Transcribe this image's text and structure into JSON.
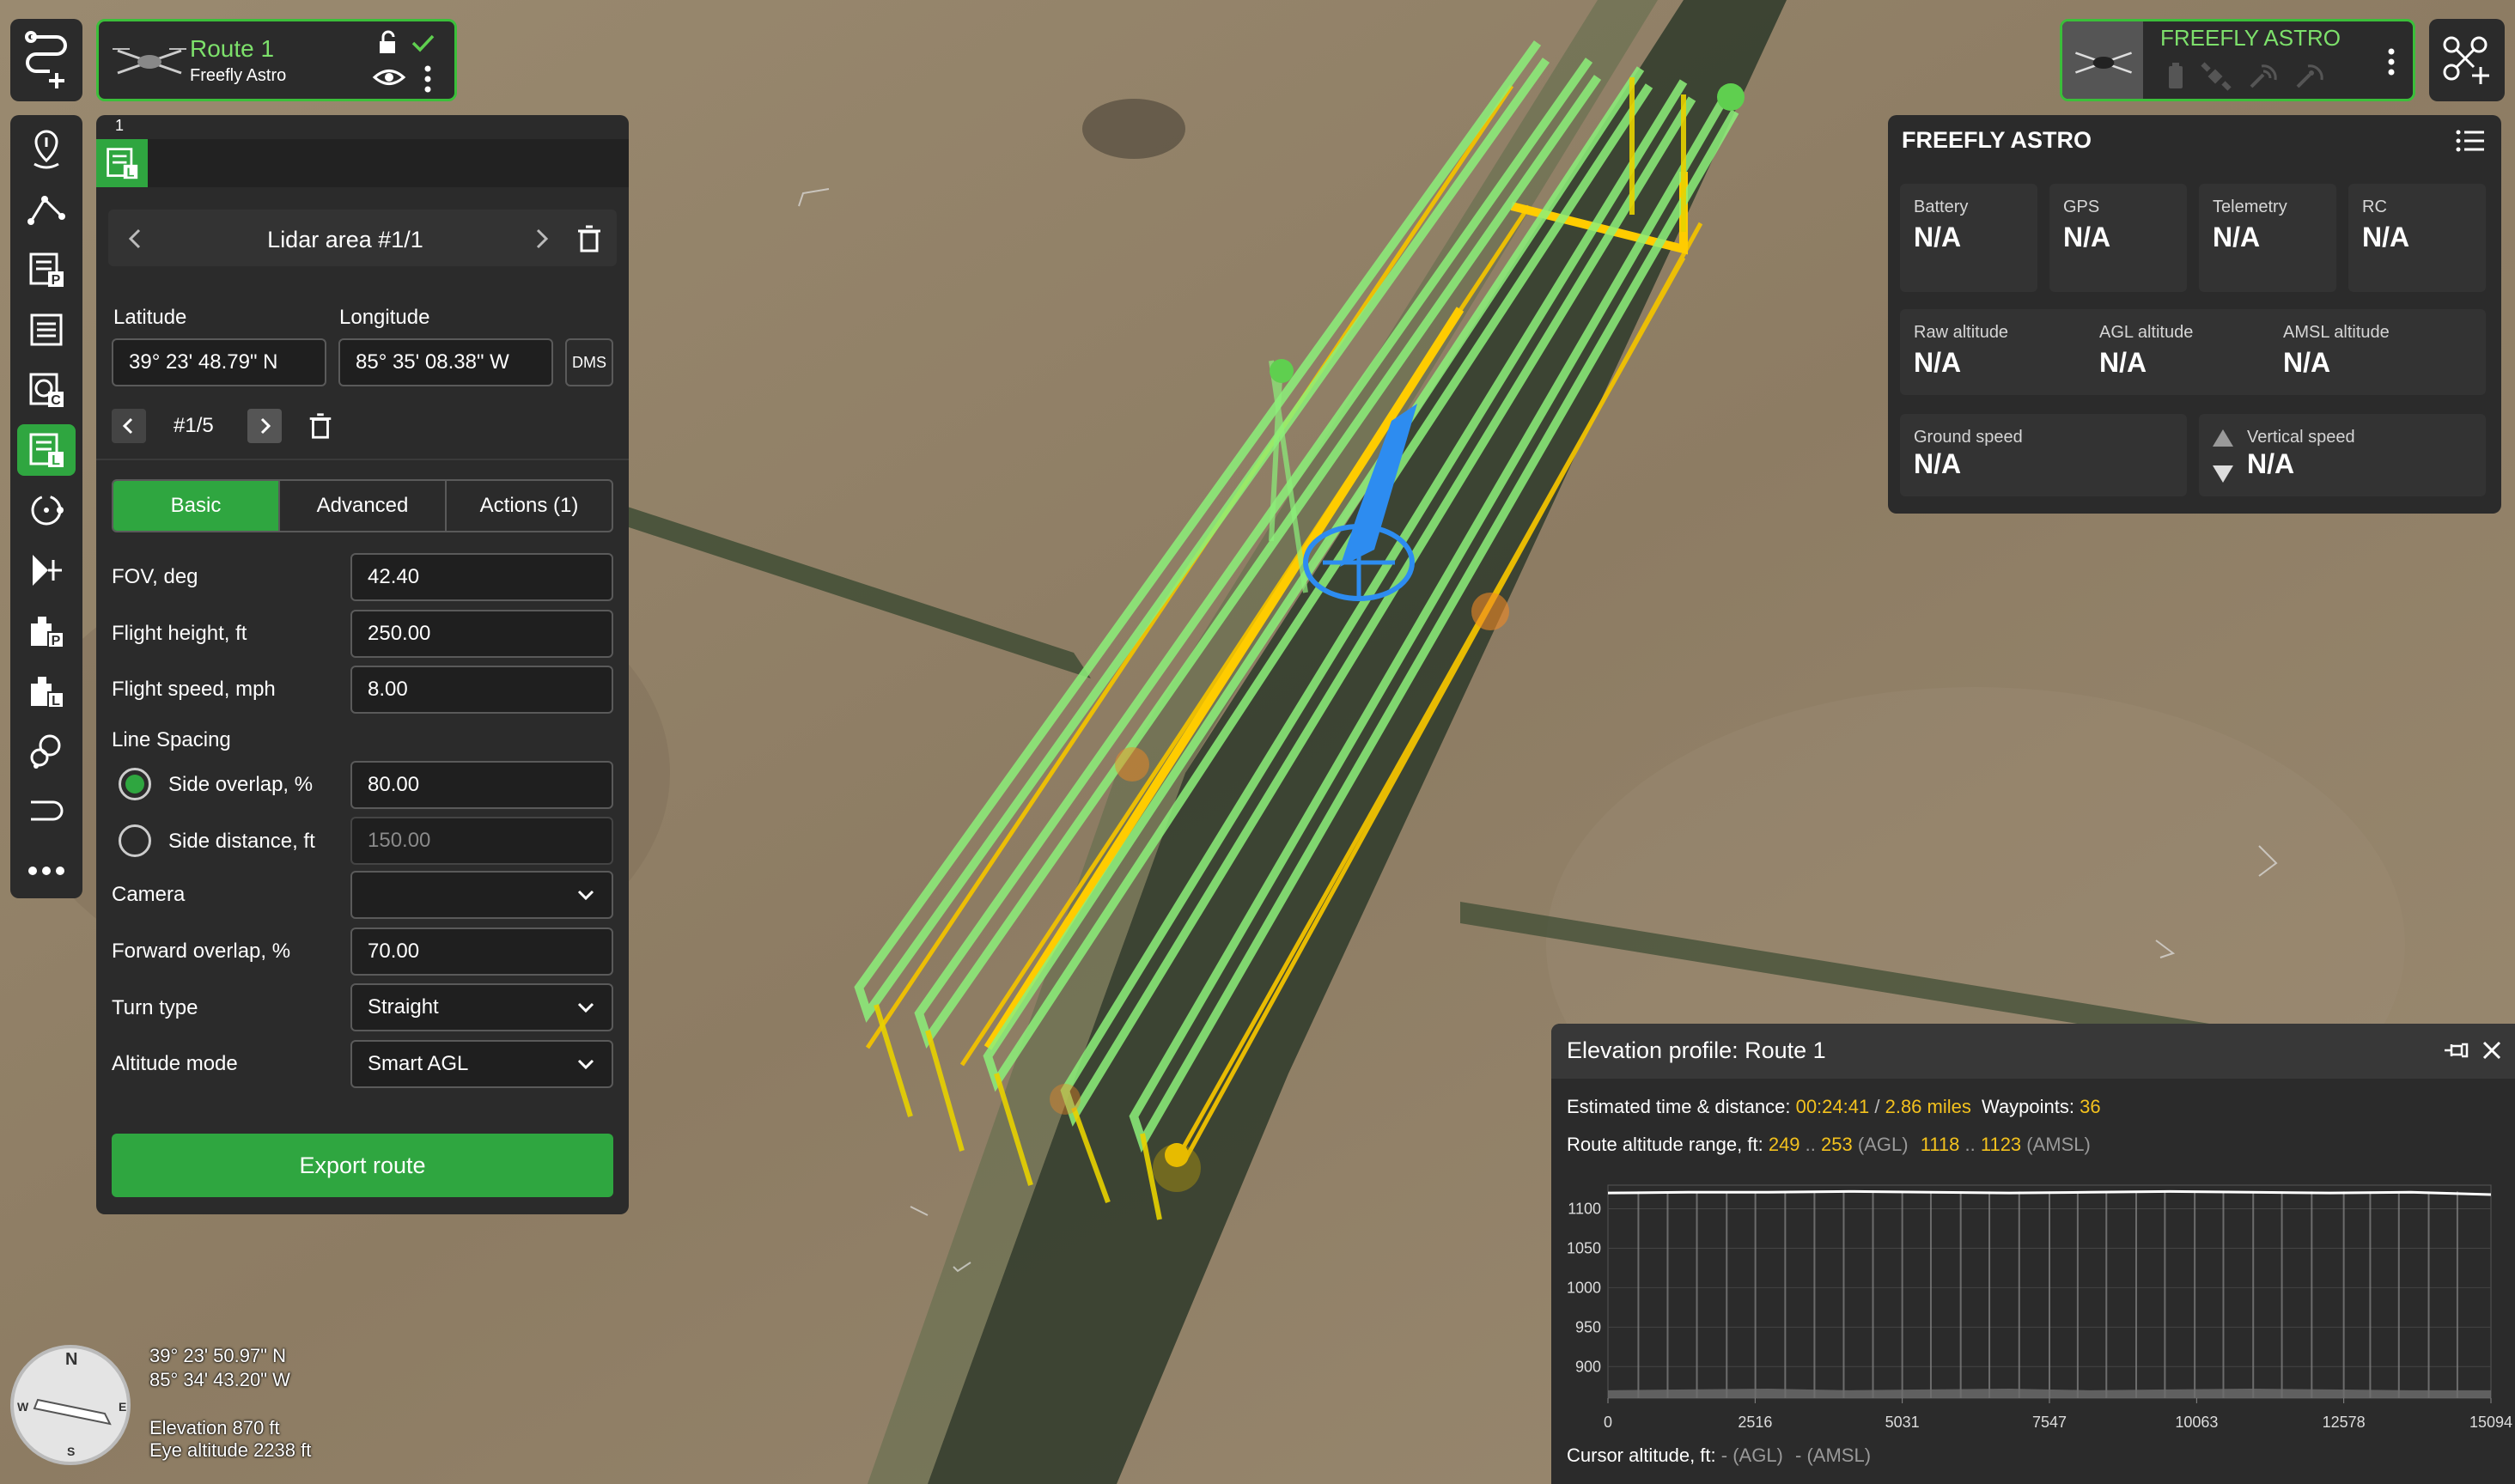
{
  "route_card": {
    "title": "Route 1",
    "subtitle": "Freefly Astro"
  },
  "drone_card": {
    "title": "FREEFLY ASTRO"
  },
  "editor": {
    "tab_number": "1",
    "area_title": "Lidar area #1/1",
    "latitude_label": "Latitude",
    "longitude_label": "Longitude",
    "latitude_value": "39° 23' 48.79\" N",
    "longitude_value": "85° 35' 08.38\" W",
    "dms_label": "DMS",
    "point_counter": "#1/5",
    "tabs": {
      "basic": "Basic",
      "advanced": "Advanced",
      "actions": "Actions (1)"
    },
    "fields": {
      "fov_label": "FOV, deg",
      "fov_value": "42.40",
      "height_label": "Flight height, ft",
      "height_value": "250.00",
      "speed_label": "Flight speed, mph",
      "speed_value": "8.00",
      "line_spacing_label": "Line Spacing",
      "side_overlap_label": "Side overlap, %",
      "side_overlap_value": "80.00",
      "side_distance_label": "Side distance, ft",
      "side_distance_value": "150.00",
      "camera_label": "Camera",
      "camera_value": "",
      "forward_overlap_label": "Forward overlap, %",
      "forward_overlap_value": "70.00",
      "turn_type_label": "Turn type",
      "turn_type_value": "Straight",
      "altitude_mode_label": "Altitude mode",
      "altitude_mode_value": "Smart AGL"
    },
    "export_label": "Export route"
  },
  "telemetry": {
    "title": "FREEFLY ASTRO",
    "battery_label": "Battery",
    "battery_value": "N/A",
    "gps_label": "GPS",
    "gps_value": "N/A",
    "telemetry_label": "Telemetry",
    "telemetry_value": "N/A",
    "rc_label": "RC",
    "rc_value": "N/A",
    "raw_alt_label": "Raw altitude",
    "raw_alt_value": "N/A",
    "agl_alt_label": "AGL altitude",
    "agl_alt_value": "N/A",
    "amsl_alt_label": "AMSL altitude",
    "amsl_alt_value": "N/A",
    "ground_speed_label": "Ground speed",
    "ground_speed_value": "N/A",
    "vertical_speed_label": "Vertical speed",
    "vertical_speed_value": "N/A"
  },
  "elevation": {
    "title": "Elevation profile: Route 1",
    "est_label": "Estimated time & distance:",
    "est_time": "00:24:41",
    "est_sep": "/",
    "est_distance": "2.86 miles",
    "waypoints_label": "Waypoints:",
    "waypoints_value": "36",
    "range_label": "Route altitude range, ft:",
    "agl_min": "249",
    "range_dots": "..",
    "agl_max": "253",
    "agl_tag": "(AGL)",
    "amsl_min": "1118",
    "amsl_max": "1123",
    "amsl_tag": "(AMSL)",
    "cursor_label": "Cursor altitude, ft:",
    "cursor_agl": "- (AGL)",
    "cursor_amsl": "- (AMSL)"
  },
  "map_info": {
    "lat": "39° 23' 50.97\" N",
    "lon": "85° 34' 43.20\" W",
    "elevation": "Elevation 870 ft",
    "eye_altitude": "Eye altitude 2238 ft",
    "compass_n": "N",
    "compass_s": "S",
    "compass_e": "E",
    "compass_w": "W"
  },
  "chart_data": {
    "type": "area",
    "title": "Elevation profile: Route 1",
    "xlabel": "",
    "ylabel": "",
    "x_ticks": [
      "0",
      "2516",
      "5031",
      "7547",
      "10063",
      "12578",
      "15094"
    ],
    "y_ticks": [
      "900",
      "1050",
      "1000",
      "950",
      "900"
    ],
    "y_ticks_display": [
      "1100",
      "1050",
      "1000",
      "950",
      "900"
    ],
    "xlim": [
      0,
      15094
    ],
    "ylim": [
      860,
      1130
    ],
    "series": [
      {
        "values": [
          1120,
          1121,
          1121,
          1122,
          1121,
          1120,
          1121,
          1122,
          1121,
          1120,
          1121,
          1118
        ]
      },
      {
        "values": [
          870,
          871,
          872,
          870,
          871,
          872,
          870,
          871,
          872,
          871,
          870,
          870
        ]
      }
    ],
    "waypoint_x": [
      520,
      1020,
      1520,
      2030,
      2520,
      3030,
      3530,
      4030,
      4530,
      5031,
      5520,
      6030,
      6520,
      7030,
      7547,
      8030,
      8520,
      9030,
      9520,
      10030,
      10520,
      11030,
      11520,
      12030,
      12578,
      13030,
      13520,
      14030,
      14520
    ]
  }
}
